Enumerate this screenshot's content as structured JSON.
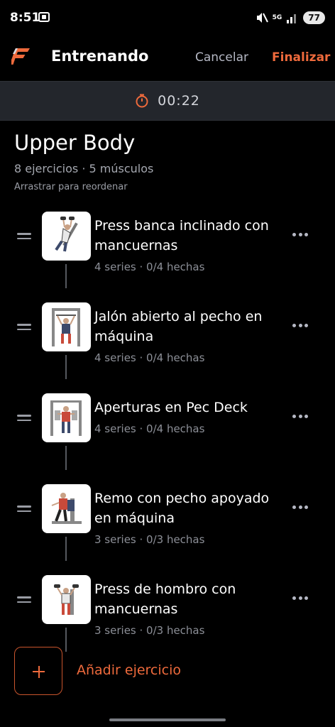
{
  "status_bar": {
    "time": "8:51",
    "network": "5G",
    "battery": "77"
  },
  "header": {
    "title": "Entrenando",
    "cancel_label": "Cancelar",
    "finish_label": "Finalizar"
  },
  "timer": {
    "elapsed": "00:22"
  },
  "workout": {
    "title": "Upper Body",
    "meta": "8 ejercicios · 5 músculos",
    "drag_hint": "Arrastrar para reordenar"
  },
  "exercises": [
    {
      "name": "Press banca inclinado con mancuernas",
      "detail": "4 series · 0/4 hechas"
    },
    {
      "name": "Jalón abierto al pecho en máquina",
      "detail": "4 series · 0/4 hechas"
    },
    {
      "name": "Aperturas en Pec Deck",
      "detail": "4 series · 0/4 hechas"
    },
    {
      "name": "Remo con pecho apoyado en máquina",
      "detail": "3 series · 0/3 hechas"
    },
    {
      "name": "Press de hombro con mancuernas",
      "detail": "3 series · 0/3 hechas"
    }
  ],
  "add_exercise_label": "Añadir ejercicio",
  "colors": {
    "accent": "#ee6a3c",
    "background": "#000000",
    "timer_bar": "#23262c"
  }
}
